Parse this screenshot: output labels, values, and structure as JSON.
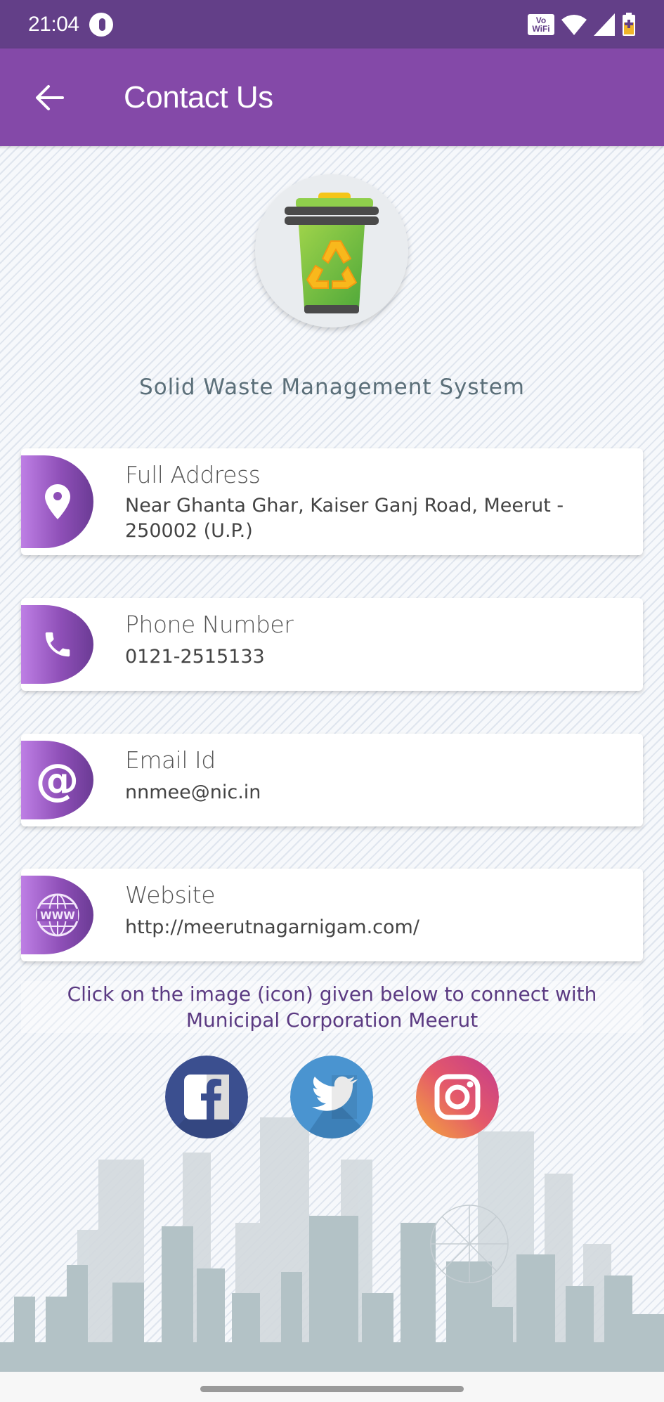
{
  "status_bar": {
    "time": "21:04",
    "vowifi_line1": "Vo",
    "vowifi_line2": "WiFi",
    "icons": [
      "notification-icon",
      "vowifi-icon",
      "wifi-icon",
      "cellular-signal-icon",
      "battery-saver-icon"
    ]
  },
  "app_bar": {
    "back_icon": "arrow-left-icon",
    "title": "Contact Us",
    "background": "#8449a8"
  },
  "header": {
    "logo_icon": "recycle-bin-icon",
    "org_name": "Solid Waste Management System"
  },
  "contacts": [
    {
      "icon": "location-pin-icon",
      "label": "Full Address",
      "value": "Near Ghanta Ghar, Kaiser Ganj Road, Meerut - 250002 (U.P.)"
    },
    {
      "icon": "phone-icon",
      "label": "Phone Number",
      "value": "0121-2515133"
    },
    {
      "icon": "at-sign-icon",
      "label": "Email Id",
      "value": "nnmee@nic.in"
    },
    {
      "icon": "globe-www-icon",
      "label": "Website",
      "value": "http://meerutnagarnigam.com/",
      "icon_text": "WWW"
    }
  ],
  "connect": {
    "text": "Click on the image (icon) given below to connect with Municipal Corporation Meerut"
  },
  "social": [
    {
      "name": "facebook",
      "icon": "facebook-icon",
      "color": "#3b4f8f"
    },
    {
      "name": "twitter",
      "icon": "twitter-icon",
      "color": "#4a94d0"
    },
    {
      "name": "instagram",
      "icon": "instagram-icon",
      "color": "#d9457a"
    }
  ],
  "colors": {
    "status_bar": "#633f88",
    "accent_purple": "#8449a8",
    "text_purple": "#5b3a82"
  }
}
